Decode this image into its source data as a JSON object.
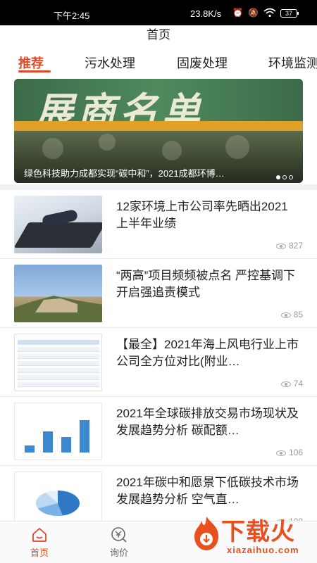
{
  "status_bar": {
    "time": "下午2:45",
    "net_speed": "23.8K/s",
    "battery": "37"
  },
  "header": {
    "title": "首页"
  },
  "tabs": [
    {
      "label": "推荐",
      "active": true
    },
    {
      "label": "污水处理",
      "active": false
    },
    {
      "label": "固废处理",
      "active": false
    },
    {
      "label": "环境监测",
      "active": false
    }
  ],
  "banner": {
    "headline": "展商名单",
    "caption": "绿色科技助力成都实现“碳中和”，2021成都环博…",
    "slide_count": 3,
    "active_slide": 0
  },
  "articles": [
    {
      "title": "12家环境上市公司率先晒出2021上半年业绩",
      "views": "827",
      "thumb": "laptop"
    },
    {
      "title": "“两高”项目频频被点名 严控基调下开启强追责模式",
      "views": "85",
      "thumb": "mountain"
    },
    {
      "title": "【最全】2021年海上风电行业上市公司全方位对比(附业…",
      "views": "74",
      "thumb": "table"
    },
    {
      "title": "2021年全球碳排放交易市场现状及发展趋势分析 碳配额…",
      "views": "106",
      "thumb": "bars"
    },
    {
      "title": "2021年碳中和愿景下低碳技术市场发展趋势分析 空气直…",
      "views": "108",
      "thumb": "pie"
    }
  ],
  "bottom_nav": [
    {
      "label": "首页",
      "icon": "home-icon",
      "active": true
    },
    {
      "label": "询价",
      "icon": "price-inquiry-icon",
      "active": false
    }
  ],
  "watermark": {
    "brand": "下载火",
    "domain": "xiazaihuo.com"
  },
  "colors": {
    "accent": "#e04a2a",
    "status_bar": "#000000"
  }
}
